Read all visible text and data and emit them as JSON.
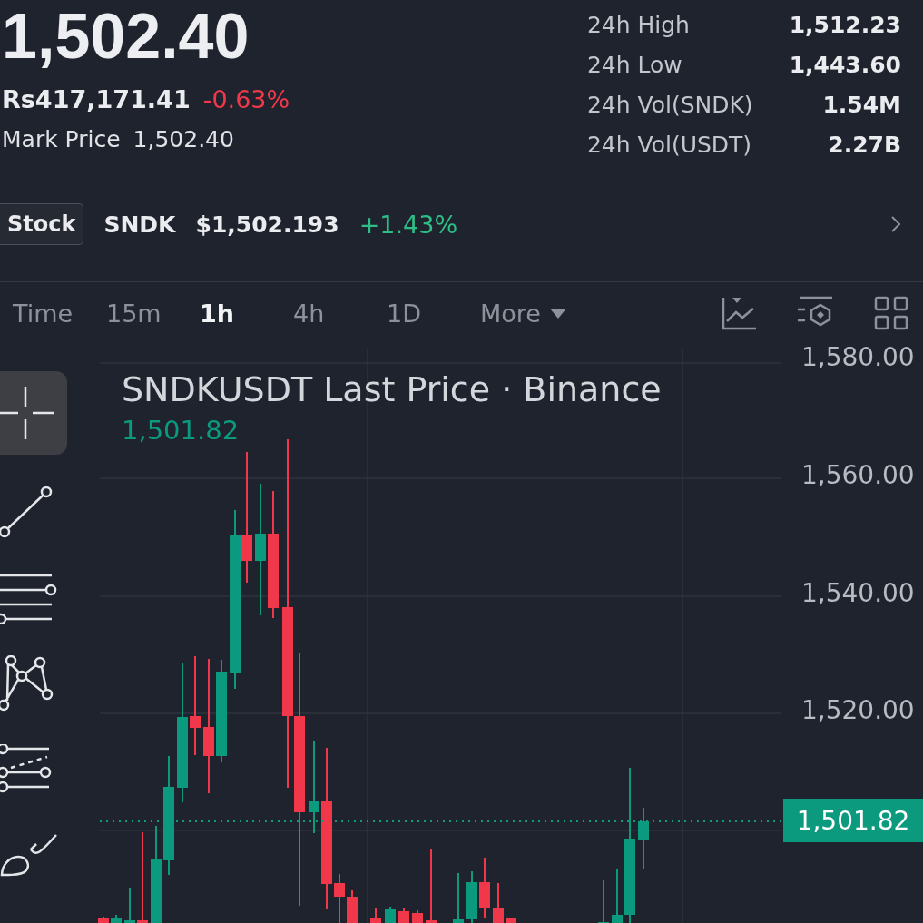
{
  "ticker": {
    "price": "1,502.40",
    "local_price": "Rs417,171.41",
    "change": "-0.63%",
    "mark_price_label": "Mark Price",
    "mark_price": "1,502.40"
  },
  "stats": [
    {
      "label": "24h High",
      "value": "1,512.23"
    },
    {
      "label": "24h Low",
      "value": "1,443.60"
    },
    {
      "label": "24h Vol(SNDK)",
      "value": "1.54M"
    },
    {
      "label": "24h Vol(USDT)",
      "value": "2.27B"
    }
  ],
  "underlying": {
    "tag": "Stock",
    "symbol": "SNDK",
    "price": "$1,502.193",
    "change": "+1.43%"
  },
  "intervals": [
    {
      "label": "Time",
      "selected": false
    },
    {
      "label": "15m",
      "selected": false
    },
    {
      "label": "1h",
      "selected": true
    },
    {
      "label": "4h",
      "selected": false
    },
    {
      "label": "1D",
      "selected": false
    },
    {
      "label": "More",
      "selected": false
    }
  ],
  "tools": [
    {
      "selected": true
    },
    {
      "selected": false
    },
    {
      "selected": false
    },
    {
      "selected": false
    },
    {
      "selected": false
    },
    {
      "selected": false
    }
  ],
  "chart": {
    "title": "SNDKUSDT Last Price · Binance",
    "last_value": "1,501.82",
    "y_axis_labels": [
      "1,580.00",
      "1,560.00",
      "1,540.00",
      "1,520.00"
    ],
    "current_price": "1,501.82"
  }
}
